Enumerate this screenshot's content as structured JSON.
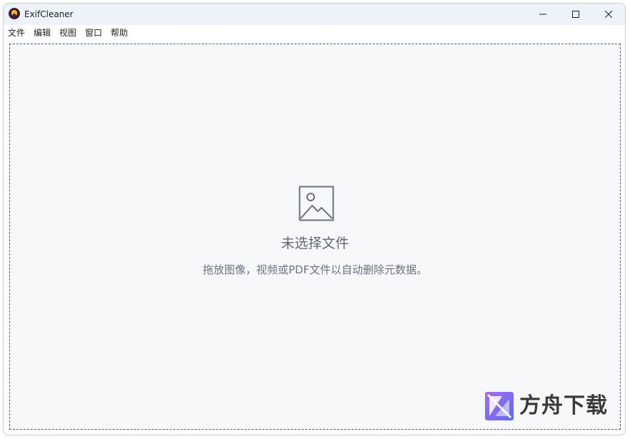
{
  "window": {
    "title": "ExifCleaner",
    "icon": "exifcleaner-app-icon"
  },
  "menu": {
    "items": [
      "文件",
      "编辑",
      "视图",
      "窗口",
      "帮助"
    ]
  },
  "dropzone": {
    "icon": "image-placeholder-icon",
    "title": "未选择文件",
    "hint": "拖放图像，视频或PDF文件以自动删除元数据。"
  },
  "watermark": {
    "text": "方舟下载",
    "colors": {
      "logo_primary": "#5b6cf0",
      "logo_secondary": "#a66bf5",
      "accent": "#f39a2b"
    }
  }
}
